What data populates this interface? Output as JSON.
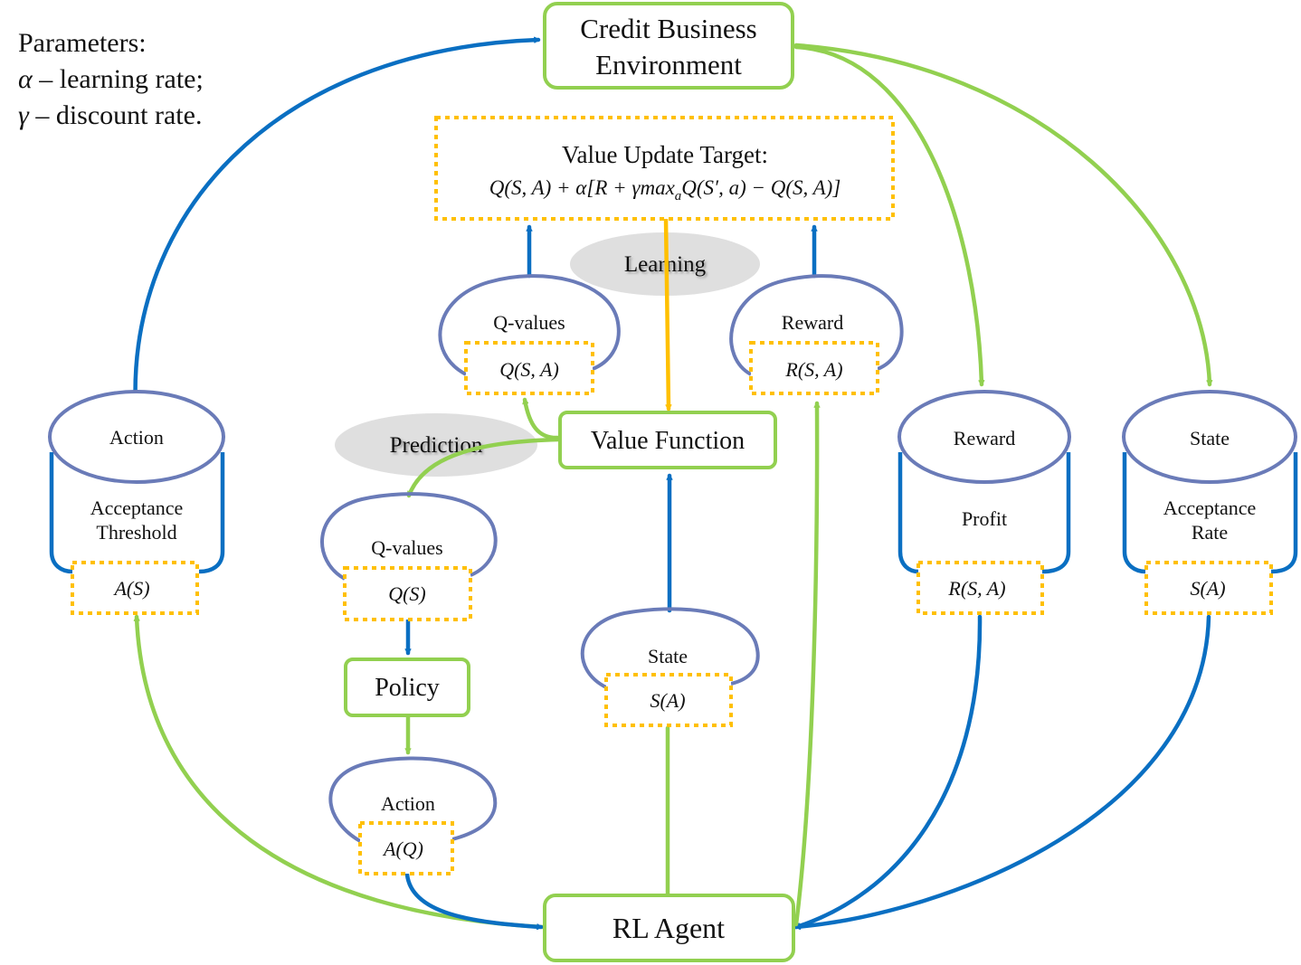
{
  "parameters": {
    "title": "Parameters:",
    "alpha_symbol": "α",
    "alpha_desc": " – learning rate;",
    "gamma_symbol": "γ",
    "gamma_desc": " – discount rate."
  },
  "environment": {
    "line1": "Credit Business",
    "line2": "Environment"
  },
  "value_update": {
    "title": "Value Update Target:",
    "formula": "Q(S, A) + α[R + γmax",
    "formula_sub": "a",
    "formula_tail": "Q(S′, a) − Q(S, A)]"
  },
  "learning_label": "Learning",
  "prediction_label": "Prediction",
  "learning_qvalues": {
    "label": "Q-values",
    "value": "Q(S, A)"
  },
  "learning_reward": {
    "label": "Reward",
    "value": "R(S, A)"
  },
  "value_function": "Value Function",
  "prediction_qvalues": {
    "label": "Q-values",
    "value": "Q(S)"
  },
  "policy": "Policy",
  "agent_action": {
    "label": "Action",
    "value": "A(Q)"
  },
  "agent_state": {
    "label": "State",
    "value": "S(A)"
  },
  "rl_agent": "RL Agent",
  "cylinders": [
    {
      "top": "Action",
      "body1": "Acceptance",
      "body2": "Threshold",
      "value": "A(S)"
    },
    {
      "top": "Reward",
      "body1": "Profit",
      "body2": "",
      "value": "R(S, A)"
    },
    {
      "top": "State",
      "body1": "Acceptance",
      "body2": "Rate",
      "value": "S(A)"
    }
  ],
  "colors": {
    "green": "#92d050",
    "blue": "#0a6fc2",
    "gold": "#ffc000",
    "ellipse": "#6a7bb8",
    "gray": "#d9d9d9"
  }
}
